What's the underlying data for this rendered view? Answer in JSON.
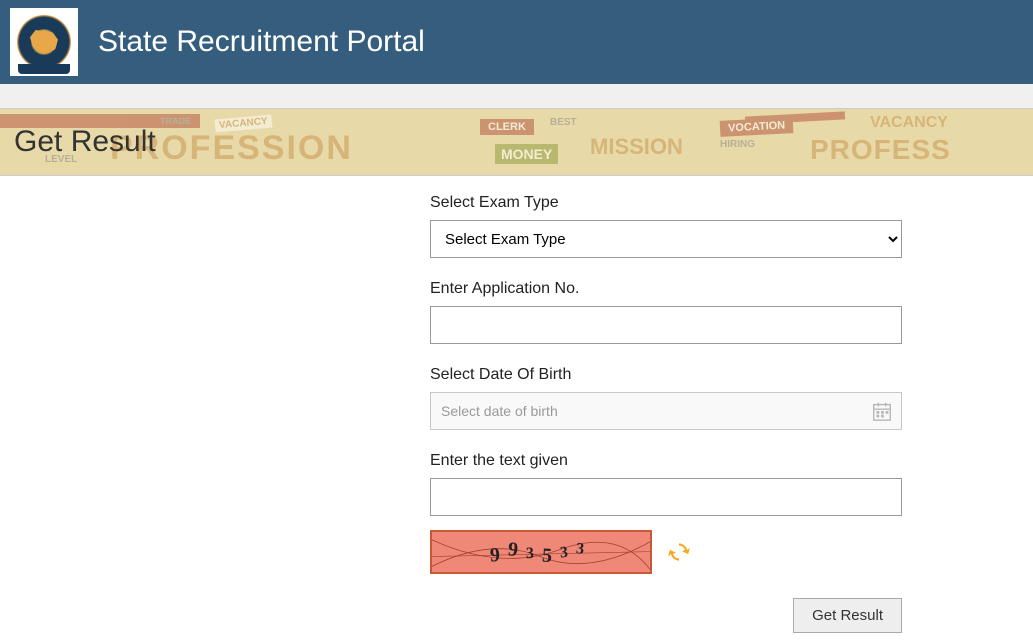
{
  "header": {
    "title": "State Recruitment Portal"
  },
  "page": {
    "title": "Get Result"
  },
  "form": {
    "exam_type": {
      "label": "Select Exam Type",
      "selected": "Select Exam Type"
    },
    "application_no": {
      "label": "Enter Application No.",
      "value": ""
    },
    "dob": {
      "label": "Select Date Of Birth",
      "placeholder": "Select date of birth"
    },
    "captcha": {
      "label": "Enter the text given",
      "value": "",
      "image_text": "993533"
    },
    "submit_label": "Get Result"
  },
  "banner_words": {
    "w1": "PROFESSION",
    "w2": "CLERK",
    "w3": "BEST",
    "w4": "MONEY",
    "w5": "MISSION",
    "w6": "VOCATION",
    "w7": "HIRING",
    "w8": "PROFESS",
    "w9": "VACANCY",
    "w10": "VACANCY",
    "w11": "LEVEL",
    "w14": "TRADE"
  }
}
